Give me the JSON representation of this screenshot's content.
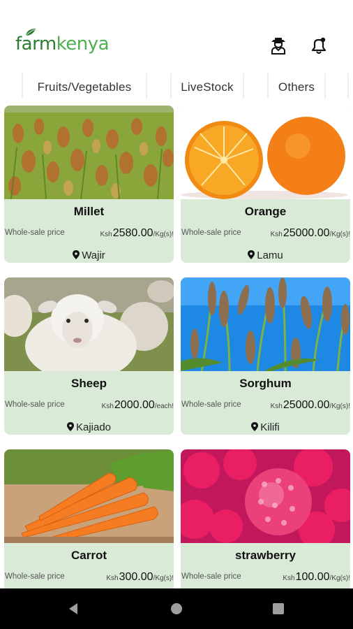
{
  "brand": {
    "part1": "farm",
    "part2": "kenya"
  },
  "header": {
    "profile_icon": "farmer-icon",
    "notification_icon": "bell-icon"
  },
  "tabs": [
    {
      "label": "Fruits/Vegetables"
    },
    {
      "label": "LiveStock"
    },
    {
      "label": "Others"
    }
  ],
  "products": [
    {
      "name": "Millet",
      "price_label": "Whole-sale price",
      "currency": "Ksh",
      "price": "2580.00",
      "unit": "/Kg(s)!",
      "location": "Wajir"
    },
    {
      "name": "Orange",
      "price_label": "Whole-sale price",
      "currency": "Ksh",
      "price": "25000.00",
      "unit": "/Kg(s)!",
      "location": "Lamu"
    },
    {
      "name": "Sheep",
      "price_label": "Whole-sale price",
      "currency": "Ksh",
      "price": "2000.00",
      "unit": "/each!",
      "location": "Kajiado"
    },
    {
      "name": "Sorghum",
      "price_label": "Whole-sale price",
      "currency": "Ksh",
      "price": "25000.00",
      "unit": "/Kg(s)!",
      "location": "Kilifi"
    },
    {
      "name": "Carrot",
      "price_label": "Whole-sale price",
      "currency": "Ksh",
      "price": "300.00",
      "unit": "/Kg(s)!",
      "location": ""
    },
    {
      "name": "strawberry",
      "price_label": "Whole-sale price",
      "currency": "Ksh",
      "price": "100.00",
      "unit": "/Kg(s)!",
      "location": ""
    }
  ],
  "nav": {
    "back": "back-icon",
    "home": "home-icon",
    "recents": "recents-icon"
  },
  "colors": {
    "brand_dark": "#2e7d32",
    "brand_light": "#4caf50",
    "card_bg": "#d9ead7"
  }
}
